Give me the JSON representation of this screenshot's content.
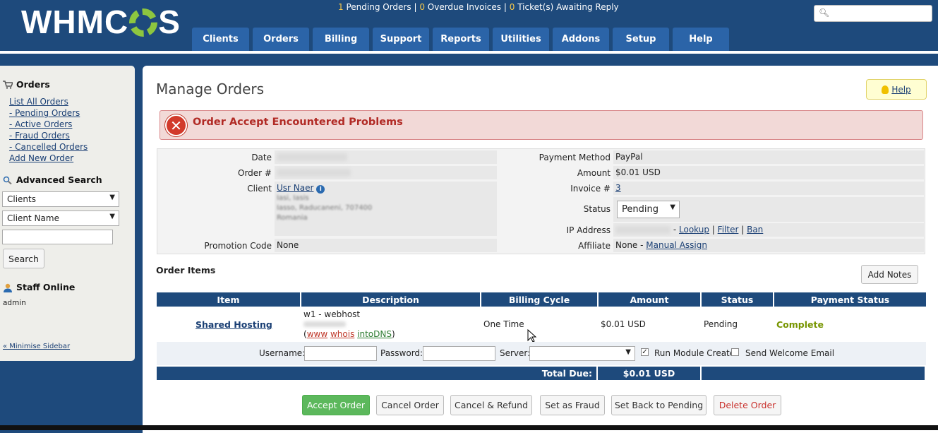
{
  "header": {
    "logo": "WHMCS",
    "stats": {
      "pending_orders_count": "1",
      "pending_orders_label": "Pending Orders",
      "overdue_count": "0",
      "overdue_label": "Overdue Invoices",
      "tickets_count": "0",
      "tickets_label": "Ticket(s) Awaiting Reply",
      "sep": "|"
    },
    "search_placeholder": ""
  },
  "nav": [
    "Clients",
    "Orders",
    "Billing",
    "Support",
    "Reports",
    "Utilities",
    "Addons",
    "Setup",
    "Help"
  ],
  "sidebar": {
    "orders_title": "Orders",
    "order_links": [
      "List All Orders",
      "- Pending Orders",
      "- Active Orders",
      "- Fraud Orders",
      "- Cancelled Orders",
      "Add New Order"
    ],
    "advanced_search_title": "Advanced Search",
    "search_type": "Clients",
    "search_field": "Client Name",
    "search_value": "",
    "search_button": "Search",
    "staff_online_title": "Staff Online",
    "staff": "admin",
    "minimise": "« Minimise Sidebar"
  },
  "page": {
    "title": "Manage Orders",
    "help": "Help",
    "alert": "Order Accept Encountered Problems"
  },
  "order_info": {
    "date_label": "Date",
    "order_label": "Order #",
    "client_label": "Client",
    "client_name": "Usr Naer",
    "client_addr1": "Iasi, Iasis",
    "client_addr2": "Iasso, Raducaneni, 707400",
    "client_addr3": "Romania",
    "promo_label": "Promotion Code",
    "promo_value": "None",
    "payment_method_label": "Payment Method",
    "payment_method": "PayPal",
    "amount_label": "Amount",
    "amount": "$0.01 USD",
    "invoice_label": "Invoice #",
    "invoice": "3",
    "status_label": "Status",
    "status": "Pending",
    "ip_label": "IP Address",
    "ip_dash": "-",
    "ip_lookup": "Lookup",
    "ip_filter": "Filter",
    "ip_ban": "Ban",
    "ip_sep": "|",
    "affiliate_label": "Affiliate",
    "affiliate_value": "None -",
    "affiliate_link": "Manual Assign"
  },
  "items": {
    "title": "Order Items",
    "add_notes": "Add Notes",
    "headers": [
      "Item",
      "Description",
      "Billing Cycle",
      "Amount",
      "Status",
      "Payment Status"
    ],
    "row": {
      "item": "Shared Hosting",
      "desc_line1": "w1 - webhost",
      "desc_www": "www",
      "desc_whois": "whois",
      "desc_intodns": "intoDNS",
      "desc_open": "(",
      "desc_close": ")",
      "billing_cycle": "One Time",
      "amount": "$0.01 USD",
      "status": "Pending",
      "payment_status": "Complete"
    },
    "module": {
      "username_label": "Username:",
      "password_label": "Password:",
      "server_label": "Server:",
      "run_module": "Run Module Create",
      "send_welcome": "Send Welcome Email"
    },
    "total_label": "Total Due:",
    "total_value": "$0.01 USD"
  },
  "buttons": {
    "accept": "Accept Order",
    "cancel": "Cancel Order",
    "cancel_refund": "Cancel & Refund",
    "fraud": "Set as Fraud",
    "back_pending": "Set Back to Pending",
    "delete": "Delete Order"
  },
  "colors": {
    "brand": "#1e4a7c",
    "accept": "#5cb85c",
    "alert_text": "#b12a25",
    "complete": "#779500"
  }
}
